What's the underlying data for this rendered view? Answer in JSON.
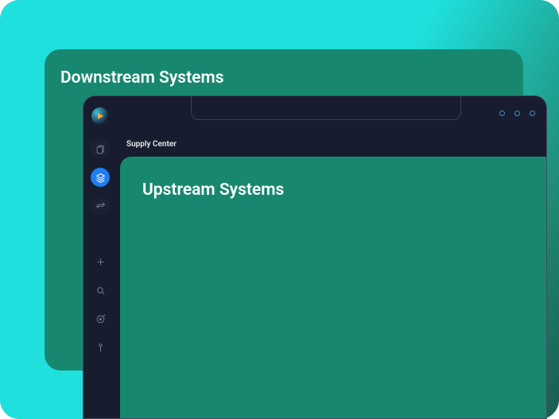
{
  "cards": {
    "downstream_title": "Downstream Systems",
    "upstream_title": "Upstream Systems"
  },
  "app": {
    "breadcrumb": "Supply Center"
  },
  "sidebar": {
    "items": [
      {
        "name": "clipboard",
        "active": false
      },
      {
        "name": "layers",
        "active": true
      },
      {
        "name": "transfer",
        "active": false
      },
      {
        "name": "add",
        "active": false
      },
      {
        "name": "search",
        "active": false
      },
      {
        "name": "target",
        "active": false
      },
      {
        "name": "pin",
        "active": false
      }
    ]
  },
  "colors": {
    "accent": "#1f7df0",
    "panel": "#17886f",
    "chrome": "#171c2e"
  }
}
